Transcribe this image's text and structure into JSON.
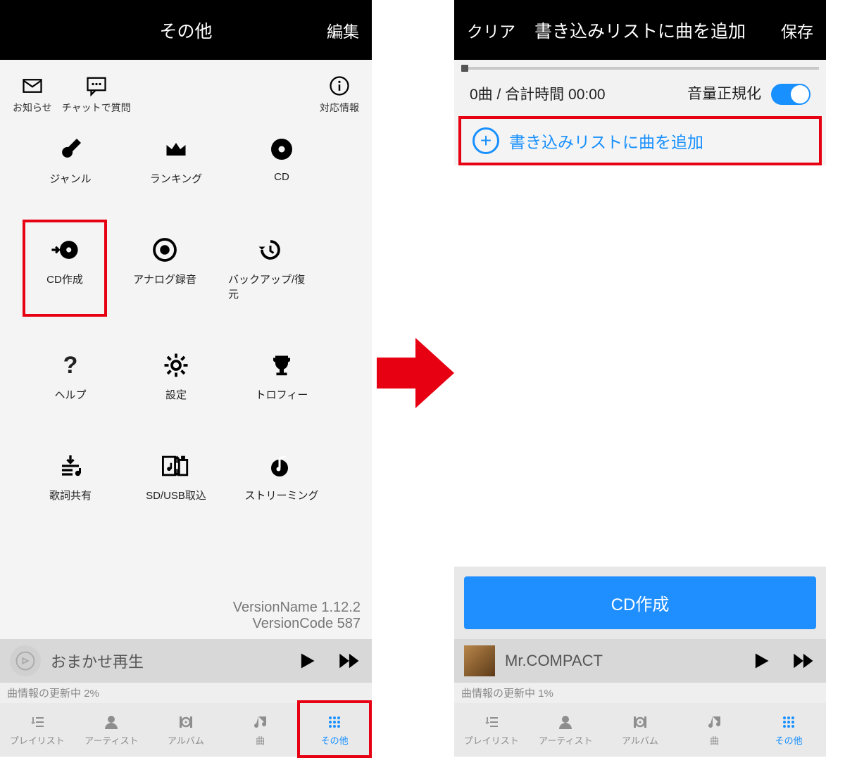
{
  "left": {
    "header": {
      "title": "その他",
      "right": "編集"
    },
    "topIcons": {
      "notice": "お知らせ",
      "chat": "チャットで質問",
      "info": "対応情報"
    },
    "grid": [
      [
        {
          "id": "genre",
          "label": "ジャンル"
        },
        {
          "id": "ranking",
          "label": "ランキング"
        },
        {
          "id": "cd",
          "label": "CD"
        }
      ],
      [
        {
          "id": "cdcreate",
          "label": "CD作成",
          "highlight": true
        },
        {
          "id": "analog",
          "label": "アナログ録音"
        },
        {
          "id": "backup",
          "label": "バックアップ/復元"
        }
      ],
      [
        {
          "id": "help",
          "label": "ヘルプ"
        },
        {
          "id": "settings",
          "label": "設定"
        },
        {
          "id": "trophy",
          "label": "トロフィー"
        }
      ],
      [
        {
          "id": "lyrics",
          "label": "歌詞共有"
        },
        {
          "id": "sdusb",
          "label": "SD/USB取込"
        },
        {
          "id": "streaming",
          "label": "ストリーミング"
        }
      ]
    ],
    "version": {
      "name": "VersionName 1.12.2",
      "code": "VersionCode 587"
    },
    "nowPlaying": {
      "track": "おまかせ再生"
    },
    "status": "曲情報の更新中 2%",
    "tabs": {
      "playlist": "プレイリスト",
      "artist": "アーティスト",
      "album": "アルバム",
      "song": "曲",
      "other": "その他"
    }
  },
  "right": {
    "header": {
      "left": "クリア",
      "title": "書き込みリストに曲を追加",
      "right": "保存"
    },
    "count": "0曲 / 合計時間 00:00",
    "normalize": "音量正規化",
    "addLabel": "書き込みリストに曲を追加",
    "cdButton": "CD作成",
    "nowPlaying": {
      "track": "Mr.COMPACT"
    },
    "status": "曲情報の更新中 1%",
    "tabs": {
      "playlist": "プレイリスト",
      "artist": "アーティスト",
      "album": "アルバム",
      "song": "曲",
      "other": "その他"
    }
  }
}
